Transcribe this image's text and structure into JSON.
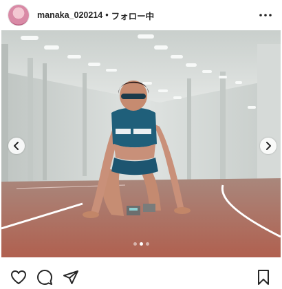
{
  "header": {
    "username": "manaka_020214",
    "separator": "•",
    "follow_status": "フォロー中",
    "avatar_icon": "profile-avatar",
    "more_icon": "more-horizontal-icon"
  },
  "carousel": {
    "prev_icon": "chevron-left-icon",
    "next_icon": "chevron-right-icon",
    "slide_count": 3,
    "active_slide": 2
  },
  "actions": {
    "like_icon": "heart-icon",
    "comment_icon": "comment-icon",
    "share_icon": "send-icon",
    "save_icon": "bookmark-icon"
  },
  "colors": {
    "text": "#262626",
    "track": "#b06a5a",
    "tunnel": "#d7dbd9",
    "uniform": "#1f5f7a"
  }
}
